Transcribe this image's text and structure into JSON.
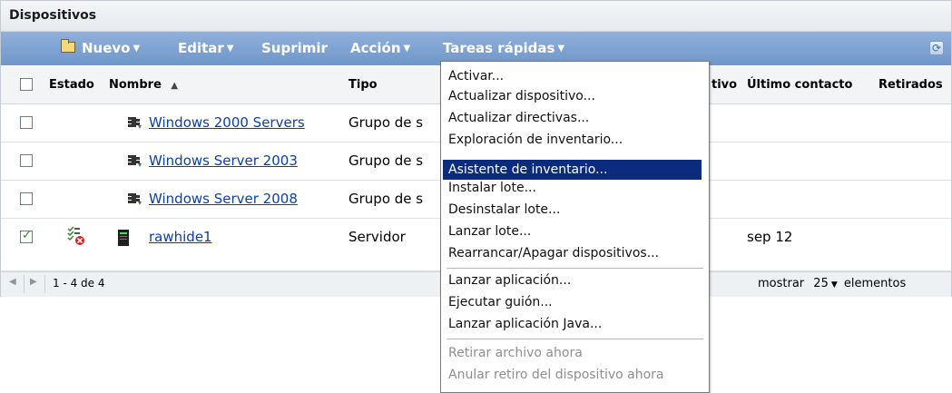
{
  "panel": {
    "title": "Dispositivos"
  },
  "toolbar": {
    "nuevo": "Nuevo",
    "editar": "Editar",
    "suprimir": "Suprimir",
    "accion": "Acción",
    "tareas": "Tareas rápidas",
    "arrow": "▼",
    "refresh_icon": "refresh-icon"
  },
  "table": {
    "headers": {
      "estado": "Estado",
      "nombre": "Nombre",
      "sort": "▲",
      "tipo": "Tipo",
      "tivo": "tivo",
      "ultimo": "Último contacto",
      "retirados": "Retirados"
    },
    "rows": [
      {
        "checked": false,
        "name": "Windows 2000 Servers",
        "tipo": "Grupo de s",
        "contacto": ""
      },
      {
        "checked": false,
        "name": "Windows Server 2003",
        "tipo": "Grupo de s",
        "contacto": ""
      },
      {
        "checked": false,
        "name": "Windows Server 2008",
        "tipo": "Grupo de s",
        "contacto": ""
      },
      {
        "checked": true,
        "name": "rawhide1",
        "tipo": "Servidor",
        "contacto": "sep 12"
      }
    ]
  },
  "footer": {
    "range": "1 - 4 de 4",
    "mostrar": "mostrar",
    "count": "25",
    "arrow": "▼",
    "elementos": "elementos"
  },
  "menu": {
    "items": [
      "Activar...",
      "Actualizar dispositivo...",
      "Actualizar directivas...",
      "Exploración de inventario...",
      "Asistente de inventario...",
      "Instalar lote...",
      "Desinstalar lote...",
      "Lanzar lote...",
      "Rearrancar/Apagar dispositivos...",
      "Lanzar aplicación...",
      "Ejecutar guión...",
      "Lanzar aplicación Java...",
      "Retirar archivo ahora",
      "Anular retiro del dispositivo ahora"
    ],
    "highlighted_index": 4,
    "disabled_indices": [
      12,
      13
    ]
  }
}
